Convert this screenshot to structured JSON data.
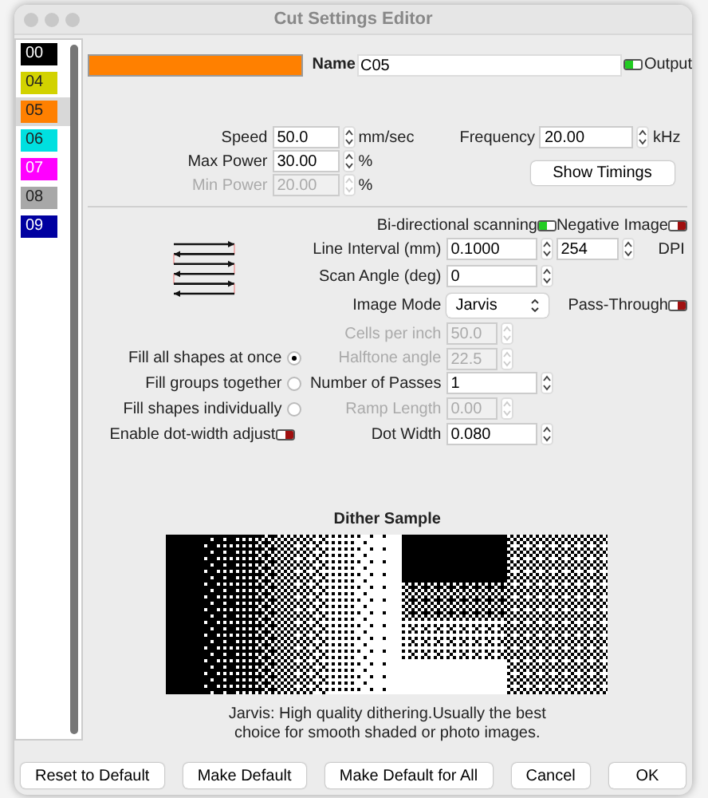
{
  "window": {
    "title": "Cut Settings Editor"
  },
  "layers": [
    {
      "label": "00",
      "color": "#000000",
      "selected": false
    },
    {
      "label": "04",
      "color": "#d2d200",
      "selected": false
    },
    {
      "label": "05",
      "color": "#ff8000",
      "selected": true
    },
    {
      "label": "06",
      "color": "#00e0e0",
      "selected": false
    },
    {
      "label": "07",
      "color": "#ff00ff",
      "selected": false
    },
    {
      "label": "08",
      "color": "#a8a8a8",
      "selected": false
    },
    {
      "label": "09",
      "color": "#0000a0",
      "selected": false
    }
  ],
  "name_field": {
    "label": "Name",
    "value": "C05"
  },
  "output_toggle": {
    "label": "Output",
    "on": true
  },
  "power_fields": [
    {
      "label": "Speed",
      "value": "50.0",
      "unit": "mm/sec",
      "disabled": false
    },
    {
      "label": "Max Power",
      "value": "30.00",
      "unit": "%",
      "disabled": false
    },
    {
      "label": "Min Power",
      "value": "20.00",
      "unit": "%",
      "disabled": true
    }
  ],
  "frequency": {
    "label": "Frequency",
    "value": "20.00",
    "unit": "kHz"
  },
  "show_timings_button": "Show Timings",
  "scan_toggles": [
    {
      "label": "Bi-directional scanning",
      "on": true
    },
    {
      "label": "Negative Image",
      "on": false
    }
  ],
  "line_interval": {
    "label": "Line Interval (mm)",
    "value": "0.1000",
    "dpi_value": "254",
    "dpi_unit": "DPI"
  },
  "scan_angle": {
    "label": "Scan Angle (deg)",
    "value": "0"
  },
  "image_mode": {
    "label": "Image Mode",
    "value": "Jarvis"
  },
  "pass_through": {
    "label": "Pass-Through",
    "on": false
  },
  "image_fields": [
    {
      "label": "Cells per inch",
      "value": "50.0",
      "disabled": true
    },
    {
      "label": "Halftone angle",
      "value": "22.5",
      "disabled": true
    },
    {
      "label": "Number of Passes",
      "value": "1",
      "disabled": false
    },
    {
      "label": "Ramp Length",
      "value": "0.00",
      "disabled": true
    },
    {
      "label": "Dot Width",
      "value": "0.080",
      "disabled": false
    }
  ],
  "fill_options": [
    {
      "label": "Fill all shapes at once",
      "selected": true
    },
    {
      "label": "Fill groups together",
      "selected": false
    },
    {
      "label": "Fill shapes individually",
      "selected": false
    }
  ],
  "dot_width_adjust": {
    "label": "Enable dot-width adjust",
    "on": false
  },
  "dither": {
    "title": "Dither Sample",
    "caption": "Jarvis: High quality dithering.Usually the best choice for smooth shaded or photo images."
  },
  "buttons": [
    "Reset to Default",
    "Make Default",
    "Make Default for All",
    "Cancel",
    "OK"
  ]
}
